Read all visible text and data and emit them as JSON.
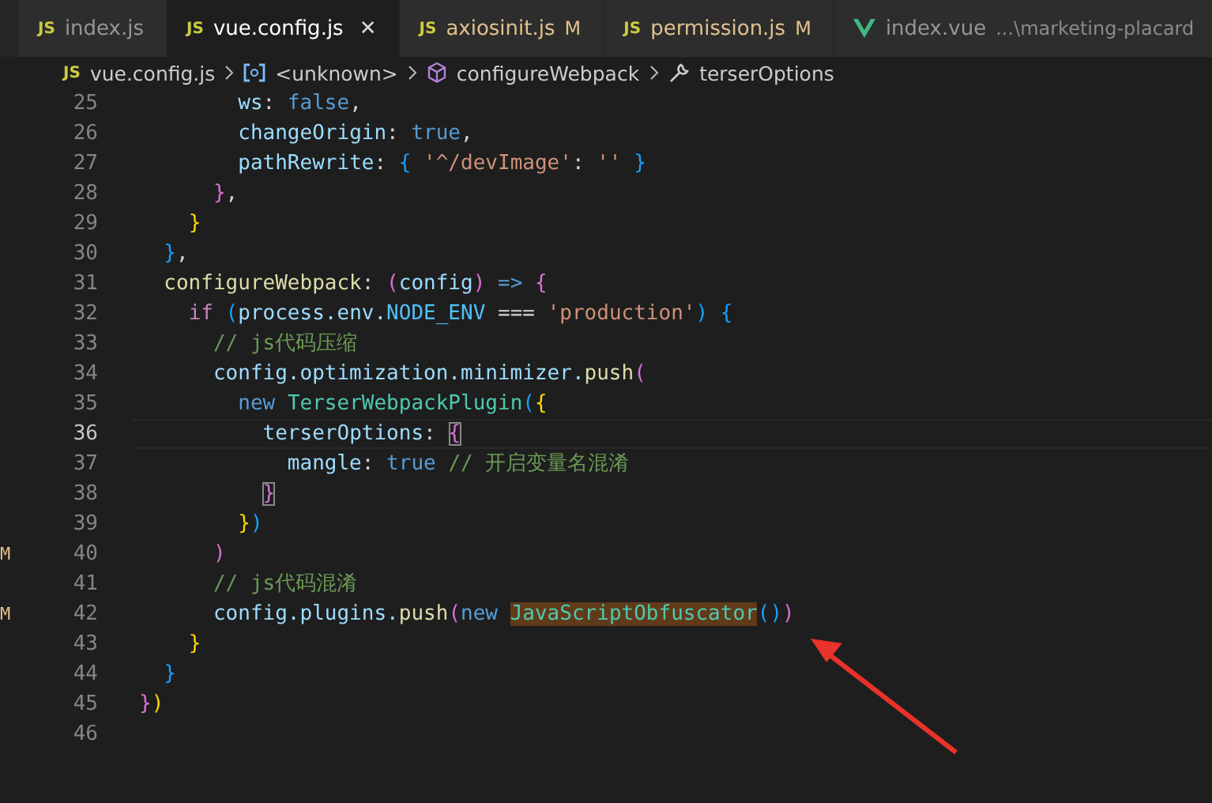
{
  "tabs": [
    {
      "kind": "js",
      "icon_label": "JS",
      "label": "index.js",
      "selected": false,
      "modified": false
    },
    {
      "kind": "js",
      "icon_label": "JS",
      "label": "vue.config.js",
      "selected": true,
      "modified": false,
      "close": "✕"
    },
    {
      "kind": "js",
      "icon_label": "JS",
      "label": "axiosinit.js",
      "selected": false,
      "modified": true,
      "badge": "M"
    },
    {
      "kind": "js",
      "icon_label": "JS",
      "label": "permission.js",
      "selected": false,
      "modified": true,
      "badge": "M"
    },
    {
      "kind": "vue",
      "label": "index.vue",
      "selected": false,
      "modified": false,
      "description": "...\\marketing-placard"
    }
  ],
  "breadcrumb": [
    {
      "kind": "file",
      "icon_label": "JS",
      "label": "vue.config.js"
    },
    {
      "kind": "variable",
      "label": "<unknown>"
    },
    {
      "kind": "method",
      "label": "configureWebpack"
    },
    {
      "kind": "property",
      "label": "terserOptions"
    }
  ],
  "lines": [
    {
      "number": "25",
      "current": false,
      "tokens": [
        {
          "kind": "prop",
          "text": "        ws"
        },
        {
          "kind": "plain",
          "text": ": "
        },
        {
          "kind": "keyword",
          "text": "false"
        },
        {
          "kind": "plain",
          "text": ","
        }
      ]
    },
    {
      "number": "26",
      "current": false,
      "tokens": [
        {
          "kind": "prop",
          "text": "        changeOrigin"
        },
        {
          "kind": "plain",
          "text": ": "
        },
        {
          "kind": "keyword",
          "text": "true"
        },
        {
          "kind": "plain",
          "text": ","
        }
      ]
    },
    {
      "number": "27",
      "current": false,
      "tokens": [
        {
          "kind": "prop",
          "text": "        pathRewrite"
        },
        {
          "kind": "plain",
          "text": ": "
        },
        {
          "kind": "bracket3",
          "text": "{ "
        },
        {
          "kind": "string",
          "text": "'^/devImage'"
        },
        {
          "kind": "plain",
          "text": ": "
        },
        {
          "kind": "string",
          "text": "'' "
        },
        {
          "kind": "bracket3",
          "text": "}"
        }
      ]
    },
    {
      "number": "28",
      "current": false,
      "tokens": [
        {
          "kind": "bracket2",
          "text": "      }"
        },
        {
          "kind": "plain",
          "text": ","
        }
      ]
    },
    {
      "number": "29",
      "current": false,
      "tokens": [
        {
          "kind": "bracket1",
          "text": "    }"
        }
      ]
    },
    {
      "number": "30",
      "current": false,
      "tokens": [
        {
          "kind": "bracket3",
          "text": "  }"
        },
        {
          "kind": "plain",
          "text": ","
        }
      ]
    },
    {
      "number": "31",
      "current": false,
      "tokens": [
        {
          "kind": "function",
          "text": "  configureWebpack"
        },
        {
          "kind": "plain",
          "text": ": "
        },
        {
          "kind": "bracket2",
          "text": "("
        },
        {
          "kind": "prop",
          "text": "config"
        },
        {
          "kind": "bracket2",
          "text": ") "
        },
        {
          "kind": "keyword",
          "text": "=> "
        },
        {
          "kind": "bracket2",
          "text": "{"
        }
      ]
    },
    {
      "number": "32",
      "current": false,
      "tokens": [
        {
          "kind": "control",
          "text": "    if "
        },
        {
          "kind": "bracket3",
          "text": "("
        },
        {
          "kind": "prop",
          "text": "process.env."
        },
        {
          "kind": "constant",
          "text": "NODE_ENV"
        },
        {
          "kind": "plain",
          "text": " === "
        },
        {
          "kind": "string",
          "text": "'production'"
        },
        {
          "kind": "bracket3",
          "text": ") {"
        }
      ]
    },
    {
      "number": "33",
      "current": false,
      "tokens": [
        {
          "kind": "comment",
          "text": "      // js代码压缩"
        }
      ]
    },
    {
      "number": "34",
      "current": false,
      "tokens": [
        {
          "kind": "prop",
          "text": "      config.optimization.minimizer."
        },
        {
          "kind": "function",
          "text": "push"
        },
        {
          "kind": "bracket2",
          "text": "("
        }
      ]
    },
    {
      "number": "35",
      "current": false,
      "tokens": [
        {
          "kind": "keyword",
          "text": "        new "
        },
        {
          "kind": "class",
          "text": "TerserWebpackPlugin"
        },
        {
          "kind": "bracket3",
          "text": "("
        },
        {
          "kind": "bracket1",
          "text": "{"
        }
      ]
    },
    {
      "number": "36",
      "current": true,
      "tokens": [
        {
          "kind": "prop",
          "text": "          terserOptions"
        },
        {
          "kind": "plain",
          "text": ": "
        },
        {
          "kind": "matched-bracket",
          "text": "{"
        }
      ]
    },
    {
      "number": "37",
      "current": false,
      "tokens": [
        {
          "kind": "prop",
          "text": "            mangle"
        },
        {
          "kind": "plain",
          "text": ": "
        },
        {
          "kind": "keyword",
          "text": "true "
        },
        {
          "kind": "comment",
          "text": "// 开启变量名混淆"
        }
      ]
    },
    {
      "number": "38",
      "current": false,
      "tokens": [
        {
          "kind": "matched-bracket",
          "text": "          }"
        }
      ]
    },
    {
      "number": "39",
      "current": false,
      "tokens": [
        {
          "kind": "bracket1",
          "text": "        }"
        },
        {
          "kind": "bracket3",
          "text": ")"
        }
      ]
    },
    {
      "number": "40",
      "current": false,
      "tokens": [
        {
          "kind": "bracket2",
          "text": "      )"
        }
      ],
      "edge_mark": "M"
    },
    {
      "number": "41",
      "current": false,
      "tokens": [
        {
          "kind": "comment",
          "text": "      // js代码混淆"
        }
      ]
    },
    {
      "number": "42",
      "current": false,
      "tokens": [
        {
          "kind": "prop",
          "text": "      config.plugins."
        },
        {
          "kind": "function",
          "text": "push"
        },
        {
          "kind": "bracket2",
          "text": "("
        },
        {
          "kind": "keyword",
          "text": "new "
        },
        {
          "kind": "highlighted-class",
          "text": "JavaScriptObfuscator"
        },
        {
          "kind": "bracket3",
          "text": "()"
        },
        {
          "kind": "bracket2",
          "text": ")"
        }
      ],
      "edge_mark": "M"
    },
    {
      "number": "43",
      "current": false,
      "tokens": [
        {
          "kind": "bracket1",
          "text": "    }"
        }
      ]
    },
    {
      "number": "44",
      "current": false,
      "tokens": [
        {
          "kind": "bracket3",
          "text": "  }"
        }
      ]
    },
    {
      "number": "45",
      "current": false,
      "tokens": [
        {
          "kind": "bracket2",
          "text": "}"
        },
        {
          "kind": "bracket1",
          "text": ")"
        }
      ]
    },
    {
      "number": "46",
      "current": false
    }
  ]
}
